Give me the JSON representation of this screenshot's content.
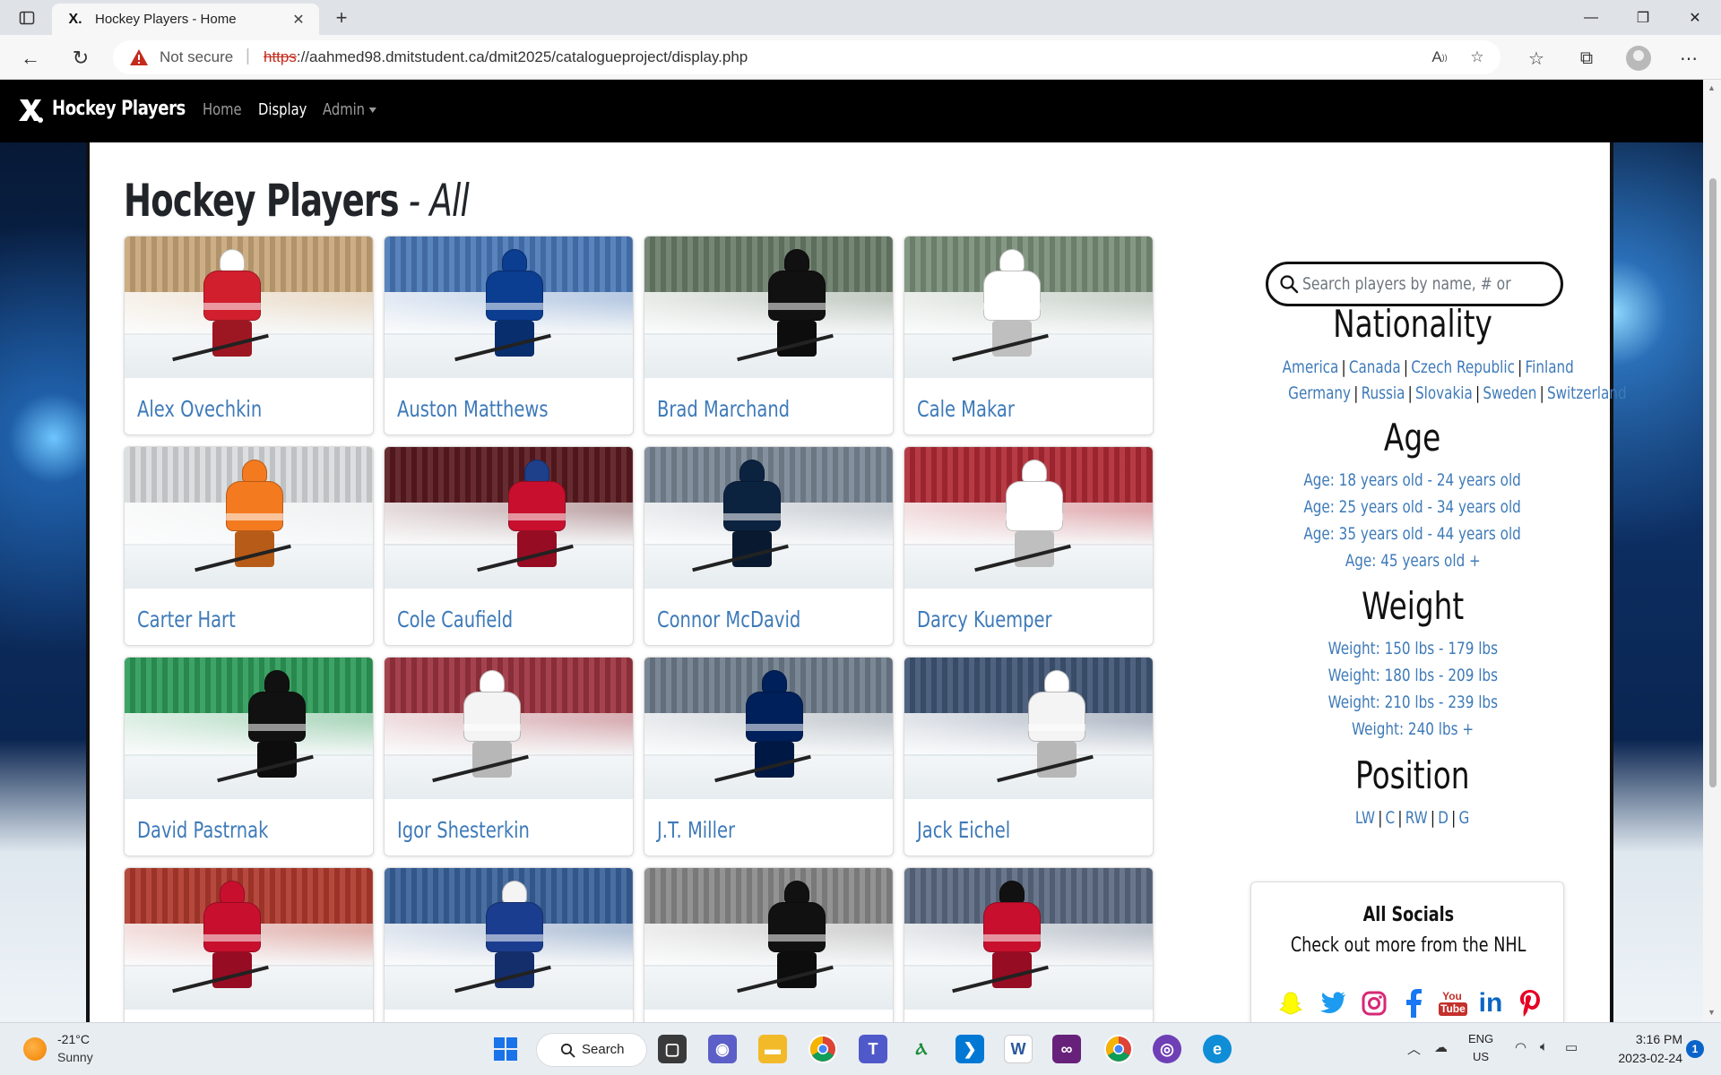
{
  "browser": {
    "tab_title": "Hockey Players - Home",
    "tab_favicon": "X.",
    "not_secure": "Not secure",
    "url_scheme": "https",
    "url_rest": "://aahmed98.dmitstudent.ca/dmit2025/catalogueproject/display.php"
  },
  "site": {
    "brand": "Hockey Players",
    "nav": {
      "home": "Home",
      "display": "Display",
      "admin": "Admin"
    },
    "page_title_main": "Hockey Players",
    "page_title_sub": " - All",
    "search_placeholder": "Search players by name, # or position"
  },
  "players": [
    {
      "name": "Alex Ovechkin",
      "jersey": "#d11f2e",
      "helmet": "#ffffff",
      "bg": "#c9a77a"
    },
    {
      "name": "Auston Matthews",
      "jersey": "#0b3d91",
      "helmet": "#0b3d91",
      "bg": "#4b79b8"
    },
    {
      "name": "Brad Marchand",
      "jersey": "#111111",
      "helmet": "#111111",
      "bg": "#6a7d6a"
    },
    {
      "name": "Cale Makar",
      "jersey": "#ffffff",
      "helmet": "#ffffff",
      "bg": "#7a8f7a"
    },
    {
      "name": "Carter Hart",
      "jersey": "#f47a20",
      "helmet": "#f47a20",
      "bg": "#d9dcde"
    },
    {
      "name": "Cole Caufield",
      "jersey": "#c8102e",
      "helmet": "#1e3f8a",
      "bg": "#5a1a20"
    },
    {
      "name": "Connor McDavid",
      "jersey": "#0c2340",
      "helmet": "#0c2340",
      "bg": "#7b8796"
    },
    {
      "name": "Darcy Kuemper",
      "jersey": "#ffffff",
      "helmet": "#ffffff",
      "bg": "#b02a35"
    },
    {
      "name": "David Pastrnak",
      "jersey": "#111111",
      "helmet": "#111111",
      "bg": "#2e9b59"
    },
    {
      "name": "Igor Shesterkin",
      "jersey": "#f4f4f4",
      "helmet": "#ffffff",
      "bg": "#9c3340"
    },
    {
      "name": "J.T. Miller",
      "jersey": "#00205b",
      "helmet": "#00205b",
      "bg": "#6f7d8c"
    },
    {
      "name": "Jack Eichel",
      "jersey": "#f4f4f4",
      "helmet": "#ffffff",
      "bg": "#405575"
    },
    {
      "name": "",
      "jersey": "#c8102e",
      "helmet": "#c8102e",
      "bg": "#b03a2e"
    },
    {
      "name": "",
      "jersey": "#1b3d8f",
      "helmet": "#f4f4f4",
      "bg": "#39629a"
    },
    {
      "name": "",
      "jersey": "#111111",
      "helmet": "#111111",
      "bg": "#8a8a8a"
    },
    {
      "name": "",
      "jersey": "#c8102e",
      "helmet": "#111111",
      "bg": "#5c6b82"
    }
  ],
  "filters": {
    "nationality_heading": "Nationality",
    "nationality_row1": [
      "America",
      "Canada",
      "Czech Republic",
      "Finland"
    ],
    "nationality_row2": [
      "Germany",
      "Russia",
      "Slovakia",
      "Sweden",
      "Switzerland"
    ],
    "age_heading": "Age",
    "age": [
      "Age: 18 years old - 24 years old",
      "Age: 25 years old - 34 years old",
      "Age: 35 years old - 44 years old",
      "Age: 45 years old +"
    ],
    "weight_heading": "Weight",
    "weight": [
      "Weight: 150 lbs - 179 lbs",
      "Weight: 180 lbs - 209 lbs",
      "Weight: 210 lbs - 239 lbs",
      "Weight: 240 lbs +"
    ],
    "position_heading": "Position",
    "positions": [
      "LW",
      "C",
      "RW",
      "D",
      "G"
    ]
  },
  "socials": {
    "title": "All Socials",
    "subtitle": "Check out more from the NHL",
    "icons": [
      "snapchat-icon",
      "twitter-icon",
      "instagram-icon",
      "facebook-icon",
      "youtube-icon",
      "linkedin-icon",
      "pinterest-icon"
    ],
    "youtube_label": "You Tube",
    "linkedin_label": "in"
  },
  "taskbar": {
    "temp": "-21°C",
    "weather": "Sunny",
    "search": "Search",
    "lang1": "ENG",
    "lang2": "US",
    "time": "3:16 PM",
    "date": "2023-02-24",
    "notifications": "1"
  },
  "colors": {
    "link": "#3e7ab8",
    "nav_bg": "#000000",
    "accent_insecure": "#c42b1c"
  }
}
